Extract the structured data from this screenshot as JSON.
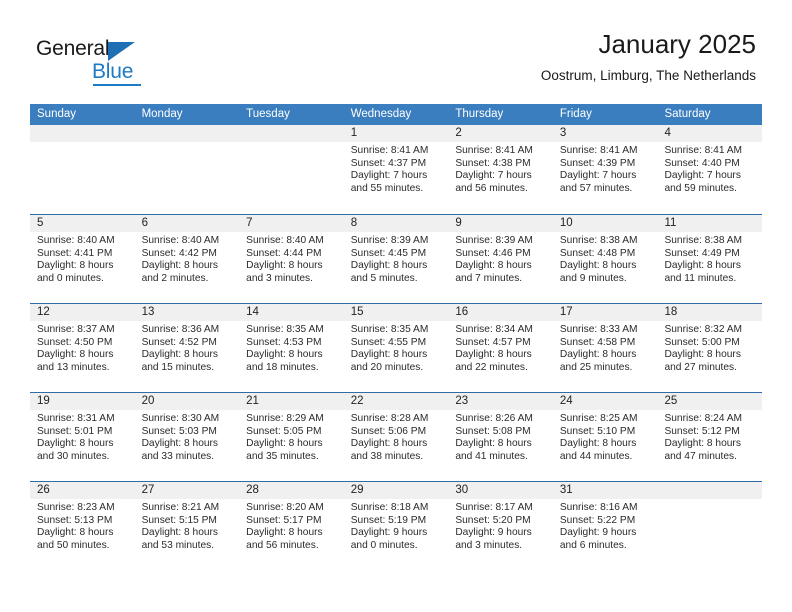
{
  "brand": {
    "name_dark": "General",
    "name_blue": "Blue",
    "accent_color": "#1f7ac4",
    "header_color": "#3a7ebf"
  },
  "header": {
    "title": "January 2025",
    "subtitle": "Oostrum, Limburg, The Netherlands"
  },
  "weekdays": [
    "Sunday",
    "Monday",
    "Tuesday",
    "Wednesday",
    "Thursday",
    "Friday",
    "Saturday"
  ],
  "weeks": [
    [
      {
        "day": "",
        "lines": []
      },
      {
        "day": "",
        "lines": []
      },
      {
        "day": "",
        "lines": []
      },
      {
        "day": "1",
        "lines": [
          "Sunrise: 8:41 AM",
          "Sunset: 4:37 PM",
          "Daylight: 7 hours",
          "and 55 minutes."
        ]
      },
      {
        "day": "2",
        "lines": [
          "Sunrise: 8:41 AM",
          "Sunset: 4:38 PM",
          "Daylight: 7 hours",
          "and 56 minutes."
        ]
      },
      {
        "day": "3",
        "lines": [
          "Sunrise: 8:41 AM",
          "Sunset: 4:39 PM",
          "Daylight: 7 hours",
          "and 57 minutes."
        ]
      },
      {
        "day": "4",
        "lines": [
          "Sunrise: 8:41 AM",
          "Sunset: 4:40 PM",
          "Daylight: 7 hours",
          "and 59 minutes."
        ]
      }
    ],
    [
      {
        "day": "5",
        "lines": [
          "Sunrise: 8:40 AM",
          "Sunset: 4:41 PM",
          "Daylight: 8 hours",
          "and 0 minutes."
        ]
      },
      {
        "day": "6",
        "lines": [
          "Sunrise: 8:40 AM",
          "Sunset: 4:42 PM",
          "Daylight: 8 hours",
          "and 2 minutes."
        ]
      },
      {
        "day": "7",
        "lines": [
          "Sunrise: 8:40 AM",
          "Sunset: 4:44 PM",
          "Daylight: 8 hours",
          "and 3 minutes."
        ]
      },
      {
        "day": "8",
        "lines": [
          "Sunrise: 8:39 AM",
          "Sunset: 4:45 PM",
          "Daylight: 8 hours",
          "and 5 minutes."
        ]
      },
      {
        "day": "9",
        "lines": [
          "Sunrise: 8:39 AM",
          "Sunset: 4:46 PM",
          "Daylight: 8 hours",
          "and 7 minutes."
        ]
      },
      {
        "day": "10",
        "lines": [
          "Sunrise: 8:38 AM",
          "Sunset: 4:48 PM",
          "Daylight: 8 hours",
          "and 9 minutes."
        ]
      },
      {
        "day": "11",
        "lines": [
          "Sunrise: 8:38 AM",
          "Sunset: 4:49 PM",
          "Daylight: 8 hours",
          "and 11 minutes."
        ]
      }
    ],
    [
      {
        "day": "12",
        "lines": [
          "Sunrise: 8:37 AM",
          "Sunset: 4:50 PM",
          "Daylight: 8 hours",
          "and 13 minutes."
        ]
      },
      {
        "day": "13",
        "lines": [
          "Sunrise: 8:36 AM",
          "Sunset: 4:52 PM",
          "Daylight: 8 hours",
          "and 15 minutes."
        ]
      },
      {
        "day": "14",
        "lines": [
          "Sunrise: 8:35 AM",
          "Sunset: 4:53 PM",
          "Daylight: 8 hours",
          "and 18 minutes."
        ]
      },
      {
        "day": "15",
        "lines": [
          "Sunrise: 8:35 AM",
          "Sunset: 4:55 PM",
          "Daylight: 8 hours",
          "and 20 minutes."
        ]
      },
      {
        "day": "16",
        "lines": [
          "Sunrise: 8:34 AM",
          "Sunset: 4:57 PM",
          "Daylight: 8 hours",
          "and 22 minutes."
        ]
      },
      {
        "day": "17",
        "lines": [
          "Sunrise: 8:33 AM",
          "Sunset: 4:58 PM",
          "Daylight: 8 hours",
          "and 25 minutes."
        ]
      },
      {
        "day": "18",
        "lines": [
          "Sunrise: 8:32 AM",
          "Sunset: 5:00 PM",
          "Daylight: 8 hours",
          "and 27 minutes."
        ]
      }
    ],
    [
      {
        "day": "19",
        "lines": [
          "Sunrise: 8:31 AM",
          "Sunset: 5:01 PM",
          "Daylight: 8 hours",
          "and 30 minutes."
        ]
      },
      {
        "day": "20",
        "lines": [
          "Sunrise: 8:30 AM",
          "Sunset: 5:03 PM",
          "Daylight: 8 hours",
          "and 33 minutes."
        ]
      },
      {
        "day": "21",
        "lines": [
          "Sunrise: 8:29 AM",
          "Sunset: 5:05 PM",
          "Daylight: 8 hours",
          "and 35 minutes."
        ]
      },
      {
        "day": "22",
        "lines": [
          "Sunrise: 8:28 AM",
          "Sunset: 5:06 PM",
          "Daylight: 8 hours",
          "and 38 minutes."
        ]
      },
      {
        "day": "23",
        "lines": [
          "Sunrise: 8:26 AM",
          "Sunset: 5:08 PM",
          "Daylight: 8 hours",
          "and 41 minutes."
        ]
      },
      {
        "day": "24",
        "lines": [
          "Sunrise: 8:25 AM",
          "Sunset: 5:10 PM",
          "Daylight: 8 hours",
          "and 44 minutes."
        ]
      },
      {
        "day": "25",
        "lines": [
          "Sunrise: 8:24 AM",
          "Sunset: 5:12 PM",
          "Daylight: 8 hours",
          "and 47 minutes."
        ]
      }
    ],
    [
      {
        "day": "26",
        "lines": [
          "Sunrise: 8:23 AM",
          "Sunset: 5:13 PM",
          "Daylight: 8 hours",
          "and 50 minutes."
        ]
      },
      {
        "day": "27",
        "lines": [
          "Sunrise: 8:21 AM",
          "Sunset: 5:15 PM",
          "Daylight: 8 hours",
          "and 53 minutes."
        ]
      },
      {
        "day": "28",
        "lines": [
          "Sunrise: 8:20 AM",
          "Sunset: 5:17 PM",
          "Daylight: 8 hours",
          "and 56 minutes."
        ]
      },
      {
        "day": "29",
        "lines": [
          "Sunrise: 8:18 AM",
          "Sunset: 5:19 PM",
          "Daylight: 9 hours",
          "and 0 minutes."
        ]
      },
      {
        "day": "30",
        "lines": [
          "Sunrise: 8:17 AM",
          "Sunset: 5:20 PM",
          "Daylight: 9 hours",
          "and 3 minutes."
        ]
      },
      {
        "day": "31",
        "lines": [
          "Sunrise: 8:16 AM",
          "Sunset: 5:22 PM",
          "Daylight: 9 hours",
          "and 6 minutes."
        ]
      },
      {
        "day": "",
        "lines": []
      }
    ]
  ]
}
